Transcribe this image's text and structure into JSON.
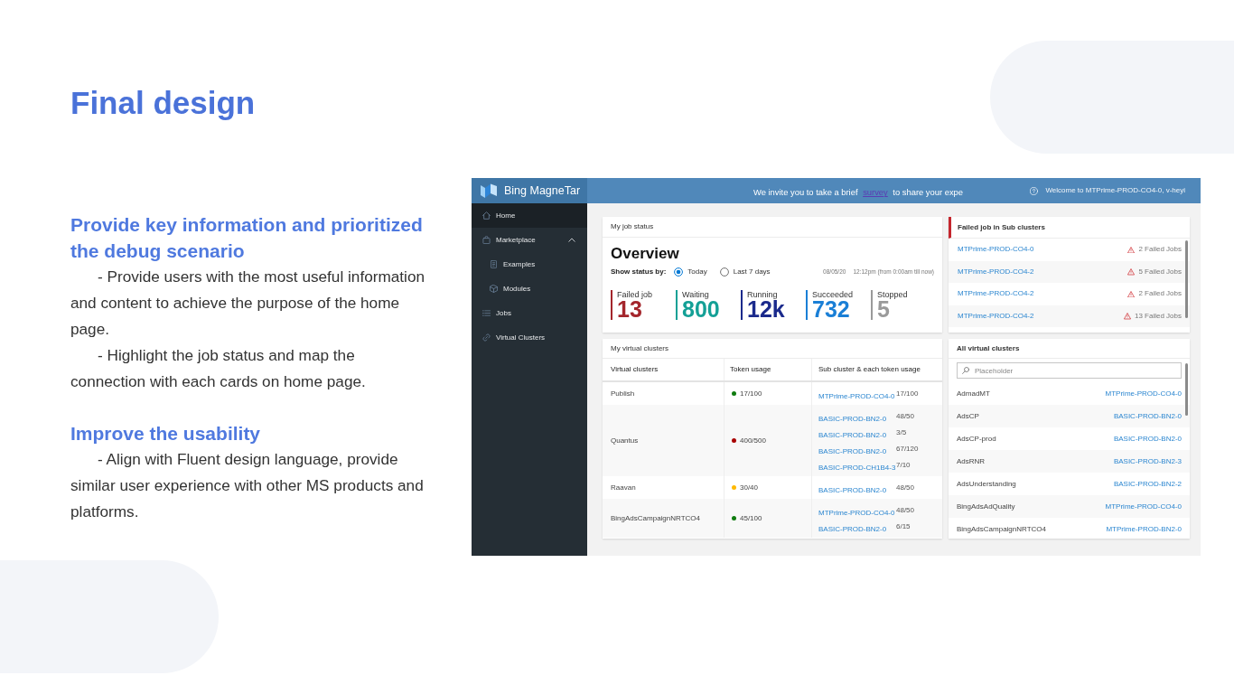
{
  "slide": {
    "title": "Final design",
    "sections": [
      {
        "heading": "Provide key information and prioritized the debug scenario",
        "paragraphs": [
          "- Provide users with the most useful information and content to achieve the purpose of the home page.",
          "- Highlight the job status and map the connection with each cards on home page."
        ]
      },
      {
        "heading": "Improve the usability",
        "paragraphs": [
          "- Align with Fluent design language, provide similar user experience with other MS products and platforms."
        ]
      }
    ]
  },
  "app": {
    "header": {
      "brand": "Bing MagneTar",
      "banner": {
        "before": "We invite you to take a brief",
        "link": "survey",
        "after": "to share your expe"
      },
      "welcome": "Welcome to MTPrime-PROD-CO4-0, v-heyi"
    },
    "sidebar": {
      "items": [
        {
          "label": "Home",
          "selected": true
        },
        {
          "label": "Marketplace",
          "selected": false,
          "expanded": true,
          "children": [
            {
              "label": "Examples",
              "selected": false
            },
            {
              "label": "Modules",
              "selected": false
            }
          ]
        },
        {
          "label": "Jobs",
          "selected": false
        },
        {
          "label": "Virtual Clusters",
          "selected": false
        }
      ]
    },
    "job_status": {
      "title": "My job status",
      "heading": "Overview",
      "filter_label": "Show status by:",
      "options": [
        {
          "label": "Today",
          "selected": true
        },
        {
          "label": "Last 7 days",
          "selected": false
        }
      ],
      "date": "08/05/20",
      "time_note": "12:12pm (from 0:00am till now)",
      "stats": [
        {
          "label": "Failed job",
          "value": "13",
          "color": "#a4262c"
        },
        {
          "label": "Waiting",
          "value": "800",
          "color": "#14a096"
        },
        {
          "label": "Running",
          "value": "12k",
          "color": "#1b2a8c"
        },
        {
          "label": "Succeeded",
          "value": "732",
          "color": "#1a7fd6"
        },
        {
          "label": "Stopped",
          "value": "5",
          "color": "#9a9a9a"
        }
      ]
    },
    "failed_jobs": {
      "title": "Failed job in Sub clusters",
      "items": [
        {
          "cluster": "MTPrime-PROD-CO4-0",
          "count": "2 Failed Jobs"
        },
        {
          "cluster": "MTPrime-PROD-CO4-2",
          "count": "5 Failed Jobs"
        },
        {
          "cluster": "MTPrime-PROD-CO4-2",
          "count": "2 Failed Jobs"
        },
        {
          "cluster": "MTPrime-PROD-CO4-2",
          "count": "13 Failed Jobs"
        }
      ]
    },
    "my_clusters": {
      "title": "My virtual clusters",
      "columns": [
        "Virtual clusters",
        "Token usage",
        "Sub cluster & each token usage"
      ],
      "rows": [
        {
          "name": "Publish",
          "usage": "17/100",
          "color": "#107c10",
          "sub_clusters": [
            {
              "name": "MTPrime-PROD-CO4-0",
              "usage": "17/100"
            }
          ]
        },
        {
          "name": "Quantus",
          "usage": "400/500",
          "color": "#a80000",
          "sub_clusters": [
            {
              "name": "BASIC-PROD-BN2-0",
              "usage": "48/50"
            },
            {
              "name": "BASIC-PROD-BN2-0",
              "usage": "3/5"
            },
            {
              "name": "BASIC-PROD-BN2-0",
              "usage": "67/120"
            },
            {
              "name": "BASIC-PROD-CH1B4-3",
              "usage": "7/10"
            }
          ]
        },
        {
          "name": "Raavan",
          "usage": "30/40",
          "color": "#ffb900",
          "sub_clusters": [
            {
              "name": "BASIC-PROD-BN2-0",
              "usage": "48/50"
            }
          ]
        },
        {
          "name": "BingAdsCampaignNRTCO4",
          "usage": "45/100",
          "color": "#107c10",
          "sub_clusters": [
            {
              "name": "MTPrime-PROD-CO4-0",
              "usage": "48/50"
            },
            {
              "name": "BASIC-PROD-BN2-0",
              "usage": "6/15"
            }
          ]
        }
      ]
    },
    "all_clusters": {
      "title": "All virtual clusters",
      "search": {
        "placeholder": "Placeholder"
      },
      "items": [
        {
          "name": "AdmadMT",
          "cluster": "MTPrime-PROD-CO4-0"
        },
        {
          "name": "AdsCP",
          "cluster": "BASIC-PROD-BN2-0"
        },
        {
          "name": "AdsCP-prod",
          "cluster": "BASIC-PROD-BN2-0"
        },
        {
          "name": "AdsRNR",
          "cluster": "BASIC-PROD-BN2-3"
        },
        {
          "name": "AdsUnderstanding",
          "cluster": "BASIC-PROD-BN2-2"
        },
        {
          "name": "BingAdsAdQuality",
          "cluster": "MTPrime-PROD-CO4-0"
        },
        {
          "name": "BingAdsCampaignNRTCO4",
          "cluster": "MTPrime-PROD-BN2-0"
        }
      ]
    }
  }
}
